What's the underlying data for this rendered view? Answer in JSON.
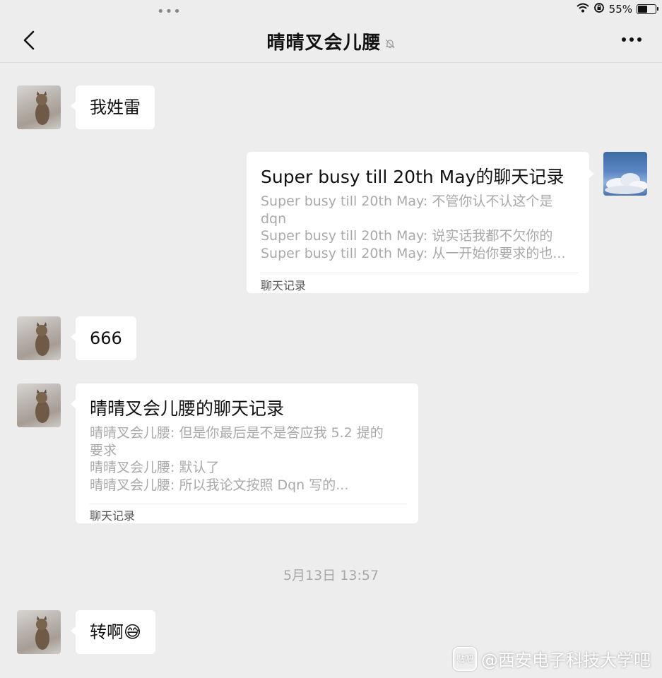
{
  "status_bar": {
    "battery": "55%",
    "battery_level": 0.55,
    "icons": [
      "wifi-icon",
      "lock-rotation-icon",
      "battery-icon"
    ]
  },
  "nav": {
    "title": "晴晴叉会儿腰",
    "back_icon": "chevron-left-icon",
    "more_icon": "more-dots-icon",
    "mute_icon": "muted-bell-icon"
  },
  "messages": [
    {
      "type": "text",
      "side": "left",
      "text": "我姓雷"
    },
    {
      "type": "record",
      "side": "right",
      "title": "Super busy till 20th May的聊天记录",
      "lines": [
        "Super busy till 20th May: 不管你认不认这个是",
        "dqn",
        "Super busy till 20th May: 说实话我都不欠你的",
        "Super busy till 20th May: 从一开始你要求的也..."
      ],
      "footer": "聊天记录"
    },
    {
      "type": "text",
      "side": "left",
      "text": "666"
    },
    {
      "type": "record",
      "side": "left",
      "title": "晴晴叉会儿腰的聊天记录",
      "lines": [
        "晴晴叉会儿腰: 但是你最后是不是答应我 5.2 提的",
        "要求",
        "晴晴叉会儿腰: 默认了",
        "晴晴叉会儿腰: 所以我论文按照 Dqn 写的..."
      ],
      "footer": "聊天记录"
    },
    {
      "type": "timestamp",
      "text": "5月13日 13:57"
    },
    {
      "type": "text",
      "side": "left",
      "text": "转啊😅"
    }
  ],
  "watermark": {
    "icon_text": "贴吧",
    "text": "@西安电子科技大学吧"
  }
}
